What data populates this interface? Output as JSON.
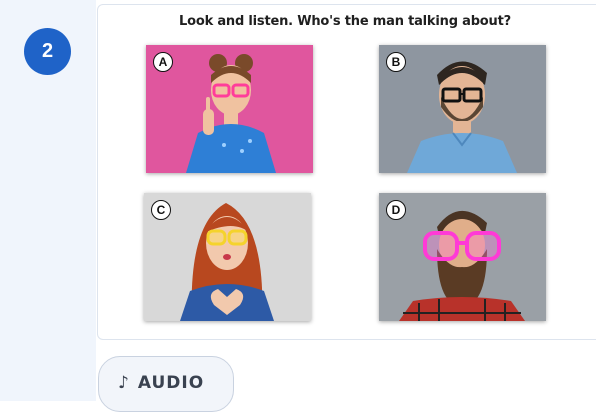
{
  "exercise": {
    "number": "2",
    "question": "Look and listen. Who's the man talking about?",
    "options": [
      {
        "letter": "A",
        "icon": "photo-woman-pink-glasses"
      },
      {
        "letter": "B",
        "icon": "photo-man-black-glasses"
      },
      {
        "letter": "C",
        "icon": "photo-woman-yellow-glasses"
      },
      {
        "letter": "D",
        "icon": "photo-man-pink-glasses"
      }
    ]
  },
  "audio": {
    "icon": "music-note-icon",
    "note_glyph": "♪",
    "label": "AUDIO"
  },
  "colors": {
    "badge": "#1f63c8",
    "sidebar": "#f0f5fc",
    "photo_a_bg": "#e0569e",
    "photo_b_bg": "#8e96a0",
    "photo_c_bg": "#d8d8d8",
    "photo_d_bg": "#9aa0a6"
  }
}
